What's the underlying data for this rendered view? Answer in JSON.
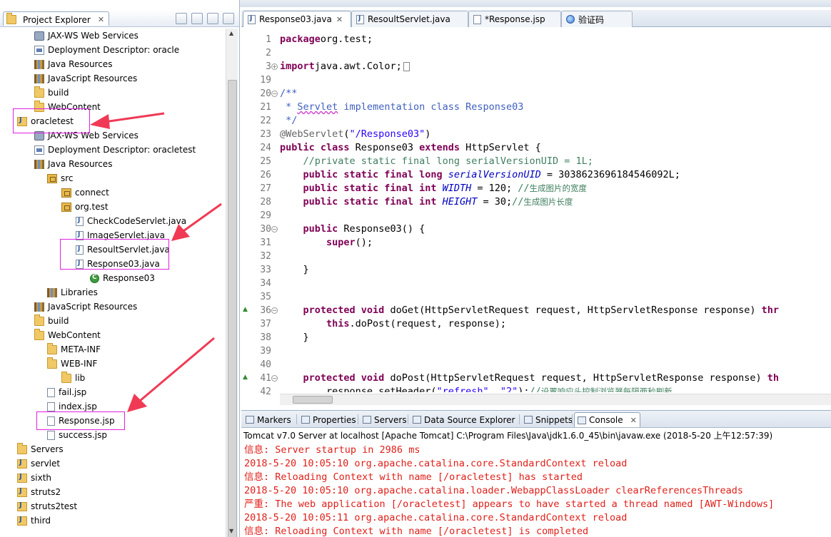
{
  "explorer": {
    "title": "Project Explorer",
    "tree": [
      {
        "label": "JAX-WS Web Services",
        "icon": "web-services-icon",
        "depth": 2
      },
      {
        "label": "Deployment Descriptor: oracle",
        "icon": "deployment-descriptor-icon",
        "depth": 2
      },
      {
        "label": "Java Resources",
        "icon": "java-resources-icon",
        "depth": 2
      },
      {
        "label": "JavaScript Resources",
        "icon": "library-icon",
        "depth": 2
      },
      {
        "label": "build",
        "icon": "folder-icon",
        "depth": 2
      },
      {
        "label": "WebContent",
        "icon": "folder-icon",
        "depth": 2
      },
      {
        "label": "oracletest",
        "icon": "project-icon",
        "depth": 1
      },
      {
        "label": "JAX-WS Web Services",
        "icon": "web-services-icon",
        "depth": 2
      },
      {
        "label": "Deployment Descriptor: oracletest",
        "icon": "deployment-descriptor-icon",
        "depth": 2
      },
      {
        "label": "Java Resources",
        "icon": "java-resources-icon",
        "depth": 2
      },
      {
        "label": "src",
        "icon": "source-folder-icon",
        "depth": 3
      },
      {
        "label": "connect",
        "icon": "package-icon",
        "depth": 4
      },
      {
        "label": "org.test",
        "icon": "package-icon",
        "depth": 4
      },
      {
        "label": "CheckCodeServlet.java",
        "icon": "java-file-icon",
        "depth": 5
      },
      {
        "label": "ImageServlet.java",
        "icon": "java-file-icon",
        "depth": 5
      },
      {
        "label": "ResoultServlet.java",
        "icon": "java-file-icon",
        "depth": 5
      },
      {
        "label": "Response03.java",
        "icon": "java-file-icon",
        "depth": 5
      },
      {
        "label": "Response03",
        "icon": "class-icon",
        "depth": 6
      },
      {
        "label": "Libraries",
        "icon": "library-icon",
        "depth": 3
      },
      {
        "label": "JavaScript Resources",
        "icon": "library-icon",
        "depth": 2
      },
      {
        "label": "build",
        "icon": "folder-icon",
        "depth": 2
      },
      {
        "label": "WebContent",
        "icon": "folder-icon",
        "depth": 2
      },
      {
        "label": "META-INF",
        "icon": "folder-icon",
        "depth": 3
      },
      {
        "label": "WEB-INF",
        "icon": "folder-icon",
        "depth": 3
      },
      {
        "label": "lib",
        "icon": "folder-icon",
        "depth": 4
      },
      {
        "label": "fail.jsp",
        "icon": "jsp-file-icon",
        "depth": 3
      },
      {
        "label": "index.jsp",
        "icon": "jsp-file-icon",
        "depth": 3
      },
      {
        "label": "Response.jsp",
        "icon": "jsp-file-icon",
        "depth": 3
      },
      {
        "label": "success.jsp",
        "icon": "jsp-file-icon",
        "depth": 3
      },
      {
        "label": "Servers",
        "icon": "folder-icon",
        "depth": 1
      },
      {
        "label": "servlet",
        "icon": "project-icon",
        "depth": 1
      },
      {
        "label": "sixth",
        "icon": "project-icon",
        "depth": 1
      },
      {
        "label": "struts2",
        "icon": "project-icon",
        "depth": 1
      },
      {
        "label": "struts2test",
        "icon": "project-icon",
        "depth": 1
      },
      {
        "label": "third",
        "icon": "project-icon",
        "depth": 1
      }
    ]
  },
  "editor": {
    "tabs": [
      {
        "label": "Response03.java",
        "active": true,
        "closable": true
      },
      {
        "label": "ResoultServlet.java",
        "active": false
      },
      {
        "label": "*Response.jsp",
        "active": false
      },
      {
        "label": "验证码",
        "active": false
      }
    ],
    "line_numbers": [
      "1",
      "2",
      "3",
      "19",
      "20",
      "21",
      "22",
      "23",
      "24",
      "25",
      "26",
      "27",
      "28",
      "29",
      "30",
      "31",
      "32",
      "33",
      "34",
      "35",
      "36",
      "37",
      "38",
      "39",
      "40",
      "41",
      "42"
    ],
    "code_lines": [
      [
        [
          "kw",
          "package"
        ],
        [
          "",
          "org.test;"
        ]
      ],
      [],
      [
        [
          "kw",
          "import"
        ],
        [
          "",
          "java.awt.Color;"
        ]
      ],
      [],
      [
        [
          "jd",
          "/**"
        ]
      ],
      [
        [
          "jd",
          " * "
        ],
        [
          "jd sq",
          "Servlet"
        ],
        [
          "jd",
          " implementation class Response03"
        ]
      ],
      [
        [
          "jd",
          " */"
        ]
      ],
      [
        [
          "an",
          "@WebServlet"
        ],
        [
          "",
          "("
        ],
        [
          "st",
          "\"/Response03\""
        ],
        [
          "",
          ")"
        ]
      ],
      [
        [
          "kw",
          "public class"
        ],
        [
          "",
          " Response03 "
        ],
        [
          "kw",
          "extends"
        ],
        [
          "",
          " HttpServlet {"
        ]
      ],
      [
        [
          "",
          "    "
        ],
        [
          "cm",
          "//private static final long serialVersionUID = 1L;"
        ]
      ],
      [
        [
          "",
          "    "
        ],
        [
          "kw",
          "public static final long"
        ],
        [
          "",
          " "
        ],
        [
          "fi",
          "serialVersionUID"
        ],
        [
          "",
          " = 3038623696184546092L;"
        ]
      ],
      [
        [
          "",
          "    "
        ],
        [
          "kw",
          "public static final int"
        ],
        [
          "",
          " "
        ],
        [
          "fi",
          "WIDTH"
        ],
        [
          "",
          " = 120; "
        ],
        [
          "cm",
          "//"
        ],
        [
          "cn",
          "生成图片的宽度"
        ]
      ],
      [
        [
          "",
          "    "
        ],
        [
          "kw",
          "public static final int"
        ],
        [
          "",
          " "
        ],
        [
          "fi",
          "HEIGHT"
        ],
        [
          "",
          " = 30;"
        ],
        [
          "cm",
          "//"
        ],
        [
          "cn",
          "生成图片长度"
        ]
      ],
      [],
      [
        [
          "",
          "    "
        ],
        [
          "kw",
          "public"
        ],
        [
          "",
          " Response03() {"
        ]
      ],
      [
        [
          "",
          "        "
        ],
        [
          "kw",
          "super"
        ],
        [
          "",
          "();"
        ]
      ],
      [],
      [
        [
          "",
          "    }"
        ]
      ],
      [],
      [],
      [
        [
          "",
          "    "
        ],
        [
          "kw",
          "protected void"
        ],
        [
          "",
          " doGet(HttpServletRequest request, HttpServletResponse response) "
        ],
        [
          "kw",
          "thr"
        ]
      ],
      [
        [
          "",
          "        "
        ],
        [
          "kw",
          "this"
        ],
        [
          "",
          ".doPost(request, response);"
        ]
      ],
      [
        [
          "",
          "    }"
        ]
      ],
      [],
      [],
      [
        [
          "",
          "    "
        ],
        [
          "kw",
          "protected void"
        ],
        [
          "",
          " doPost(HttpServletRequest request, HttpServletResponse response) "
        ],
        [
          "kw",
          "th"
        ]
      ],
      [
        [
          "",
          "        response.setHeader("
        ],
        [
          "st",
          "\"refresh\""
        ],
        [
          "",
          ", "
        ],
        [
          "st",
          "\"2\""
        ],
        [
          "",
          ");"
        ],
        [
          "cm",
          "//"
        ],
        [
          "cn",
          "设置响应头控制浏览器每隔两秒刷新"
        ]
      ]
    ]
  },
  "bottom_panel": {
    "tabs": [
      {
        "label": "Markers",
        "icon": "markers-icon"
      },
      {
        "label": "Properties",
        "icon": "properties-icon"
      },
      {
        "label": "Servers",
        "icon": "servers-icon"
      },
      {
        "label": "Data Source Explorer",
        "icon": "data-source-icon"
      },
      {
        "label": "Snippets",
        "icon": "snippets-icon"
      },
      {
        "label": "Console",
        "icon": "console-icon",
        "active": true
      }
    ],
    "console_header": "Tomcat v7.0 Server at localhost [Apache Tomcat] C:\\Program Files\\Java\\jdk1.6.0_45\\bin\\javaw.exe (2018-5-20 上午12:57:39)",
    "console_lines": [
      "信息: Server startup in 2986 ms",
      "2018-5-20 10:05:10 org.apache.catalina.core.StandardContext reload",
      "信息: Reloading Context with name [/oracletest] has started",
      "2018-5-20 10:05:10 org.apache.catalina.loader.WebappClassLoader clearReferencesThreads",
      "严重: The web application [/oracletest] appears to have started a thread named [AWT-Windows]",
      "2018-5-20 10:05:11 org.apache.catalina.core.StandardContext reload",
      "信息: Reloading Context with name [/oracletest] is completed"
    ]
  },
  "colors": {
    "keyword": "#7f0055",
    "comment": "#3f7f5f",
    "string": "#2a00ff",
    "console_text": "#e0201a",
    "highlight_box": "#e020e0",
    "annotation_arrow": "#f03a55"
  }
}
